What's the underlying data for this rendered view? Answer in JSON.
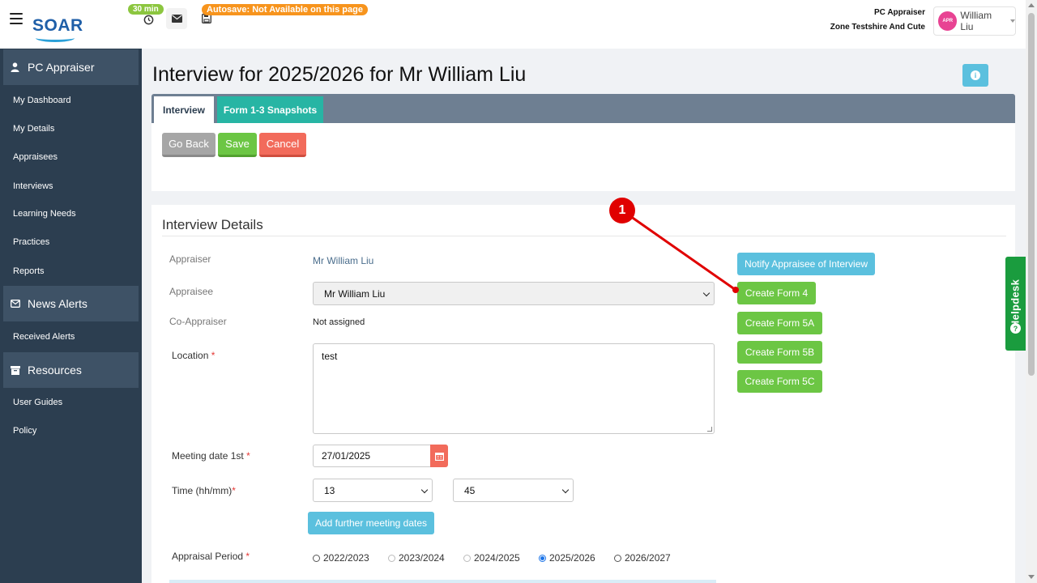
{
  "topbar": {
    "logo": "SOAR",
    "timer_badge": "30 min",
    "autosave_badge": "Autosave: Not Available on this page",
    "role_title": "PC Appraiser",
    "zone": "Zone Testshire And Cute",
    "avatar_text": "APR",
    "user_name": "William Liu"
  },
  "sidebar": {
    "sections": [
      {
        "label": "PC Appraiser",
        "icon": "user-icon"
      },
      {
        "label": "News Alerts",
        "icon": "envelope-icon"
      },
      {
        "label": "Resources",
        "icon": "archive-icon"
      }
    ],
    "appraiser_items": [
      "My Dashboard",
      "My Details",
      "Appraisees",
      "Interviews",
      "Learning Needs",
      "Practices",
      "Reports"
    ],
    "news_items": [
      "Received Alerts"
    ],
    "resource_items": [
      "User Guides",
      "Policy"
    ]
  },
  "page": {
    "title": "Interview for 2025/2026 for Mr William Liu",
    "tabs": [
      "Interview",
      "Form 1-3 Snapshots"
    ],
    "active_tab": "Interview"
  },
  "actions": {
    "go_back": "Go Back",
    "save": "Save",
    "cancel": "Cancel"
  },
  "details": {
    "title": "Interview Details",
    "appraiser_label": "Appraiser",
    "appraiser_value": "Mr William Liu",
    "appraisee_label": "Appraisee",
    "appraisee_value": "Mr William Liu",
    "coappraiser_label": "Co-Appraiser",
    "coappraiser_value": "Not assigned",
    "location_label": "Location",
    "location_value": "test",
    "meeting_label": "Meeting date 1st",
    "meeting_value": "27/01/2025",
    "time_label": "Time (hh/mm)",
    "time_hour": "13",
    "time_minute": "45",
    "add_dates": "Add further meeting dates",
    "period_label": "Appraisal Period",
    "required_mark": "*",
    "periods": [
      {
        "label": "2022/2023",
        "state": "enabled"
      },
      {
        "label": "2023/2024",
        "state": "disabled"
      },
      {
        "label": "2024/2025",
        "state": "disabled"
      },
      {
        "label": "2025/2026",
        "state": "selected"
      },
      {
        "label": "2026/2027",
        "state": "enabled"
      }
    ]
  },
  "side_actions": {
    "notify": "Notify Appraisee of Interview",
    "form4": "Create Form 4",
    "form5a": "Create Form 5A",
    "form5b": "Create Form 5B",
    "form5c": "Create Form 5C"
  },
  "helpdesk": "Helpdesk",
  "annotation": {
    "number": "1",
    "color": "#e00000"
  },
  "colors": {
    "sidebar": "#2c3e50",
    "green": "#6cc644",
    "info": "#5bc0de",
    "danger": "#f26b5b",
    "teal": "#27b5a4"
  }
}
